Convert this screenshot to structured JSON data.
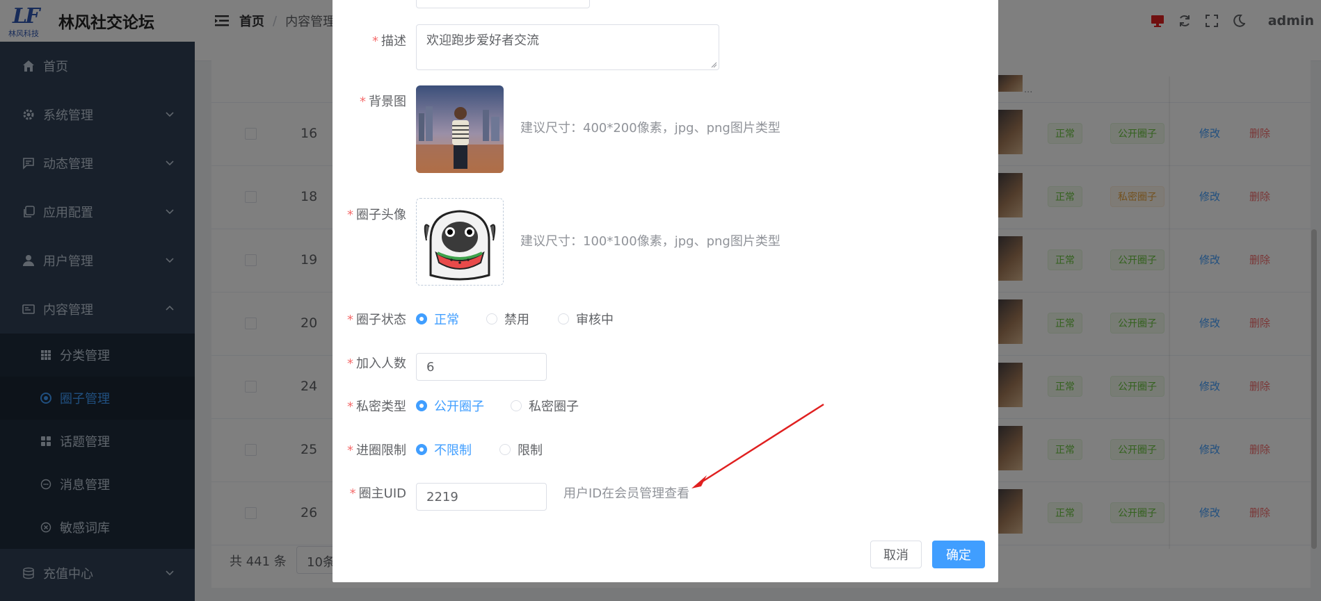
{
  "app": {
    "logo_mark": "LF",
    "logo_sub": "林风科技",
    "title": "林风社交论坛"
  },
  "header": {
    "breadcrumb": [
      "首页",
      "/",
      "内容管理"
    ],
    "user": "admin"
  },
  "sidebar": {
    "items": [
      {
        "label": "首页"
      },
      {
        "label": "系统管理"
      },
      {
        "label": "动态管理"
      },
      {
        "label": "应用配置"
      },
      {
        "label": "用户管理"
      },
      {
        "label": "内容管理"
      }
    ],
    "sub_items": [
      {
        "label": "分类管理"
      },
      {
        "label": "圈子管理"
      },
      {
        "label": "话题管理"
      },
      {
        "label": "消息管理"
      },
      {
        "label": "敏感词库"
      }
    ],
    "bottom_item": {
      "label": "充值中心"
    }
  },
  "table": {
    "rows": [
      {
        "id": "16",
        "status": "正常",
        "privacy": "公开圈子",
        "edit": "修改",
        "delete": "删除"
      },
      {
        "id": "18",
        "status": "正常",
        "privacy": "私密圈子",
        "edit": "修改",
        "delete": "删除"
      },
      {
        "id": "19",
        "status": "正常",
        "privacy": "公开圈子",
        "edit": "修改",
        "delete": "删除"
      },
      {
        "id": "20",
        "status": "正常",
        "privacy": "公开圈子",
        "edit": "修改",
        "delete": "删除"
      },
      {
        "id": "24",
        "status": "正常",
        "privacy": "公开圈子",
        "edit": "修改",
        "delete": "删除"
      },
      {
        "id": "25",
        "status": "正常",
        "privacy": "公开圈子",
        "edit": "修改",
        "delete": "删除"
      },
      {
        "id": "26",
        "status": "正常",
        "privacy": "公开圈子",
        "edit": "修改",
        "delete": "删除"
      }
    ],
    "more": "...",
    "pager_total": "共 441 条",
    "pager_size": "10条"
  },
  "dialog": {
    "desc": {
      "label": "描述",
      "value": "欢迎跑步爱好者交流"
    },
    "bg_image": {
      "label": "背景图",
      "hint": "建议尺寸：400*200像素，jpg、png图片类型"
    },
    "avatar": {
      "label": "圈子头像",
      "hint": "建议尺寸：100*100像素，jpg、png图片类型"
    },
    "status": {
      "label": "圈子状态",
      "options": [
        "正常",
        "禁用",
        "审核中"
      ],
      "selected": "正常"
    },
    "join_count": {
      "label": "加入人数",
      "value": "6"
    },
    "privacy": {
      "label": "私密类型",
      "options": [
        "公开圈子",
        "私密圈子"
      ],
      "selected": "公开圈子"
    },
    "join_limit": {
      "label": "进圈限制",
      "options": [
        "不限制",
        "限制"
      ],
      "selected": "不限制"
    },
    "owner_uid": {
      "label": "圈主UID",
      "value": "2219",
      "hint": "用户ID在会员管理查看"
    },
    "required_mark": "*",
    "cancel": "取消",
    "confirm": "确定"
  },
  "colors": {
    "primary": "#409eff",
    "danger": "#f56c6c",
    "success": "#67c23a",
    "warning": "#e6a23c",
    "sidebar_bg": "#304156",
    "annotation_arrow": "#e02020"
  }
}
